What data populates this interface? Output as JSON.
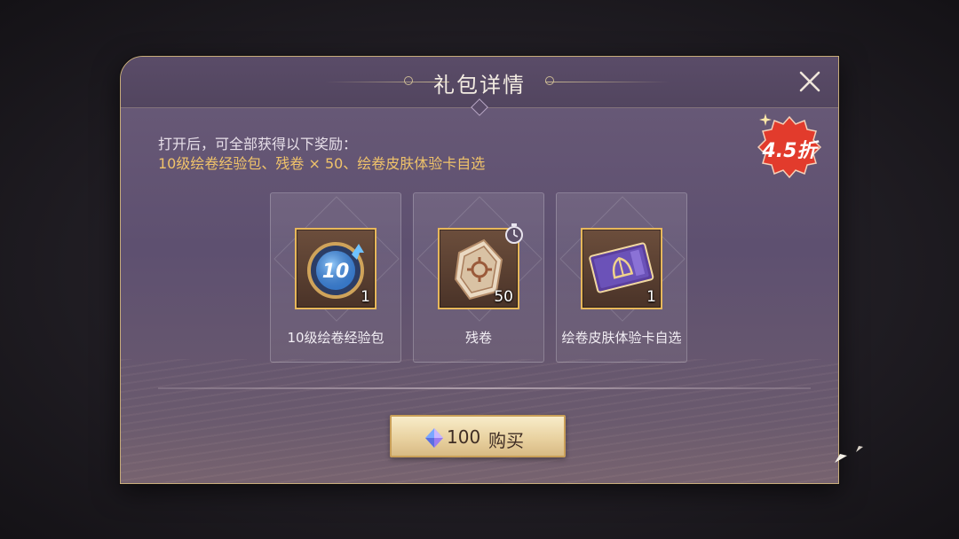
{
  "dialog": {
    "title": "礼包详情",
    "close_icon": "close-x-icon",
    "discount_badge": "4.5折",
    "intro_text": "打开后，可全部获得以下奖励：",
    "rewards_summary": "10级绘卷经验包、残卷 × 50、绘卷皮肤体验卡自选"
  },
  "items": [
    {
      "name": "10级绘卷经验包",
      "count": "1",
      "icon": "exp-pack-icon"
    },
    {
      "name": "残卷",
      "count": "50",
      "icon": "scroll-fragment-icon",
      "timed": true
    },
    {
      "name": "绘卷皮肤体验卡自选",
      "count": "1",
      "icon": "skin-trial-card-icon"
    }
  ],
  "buy_button": {
    "price": "100",
    "label": "购买",
    "currency_icon": "crystal-gem-icon"
  },
  "colors": {
    "accent_gold": "#e7b75a",
    "highlight_text": "#f0c36a",
    "badge_red": "#e23b2c",
    "panel_purple": "#5e5070"
  }
}
